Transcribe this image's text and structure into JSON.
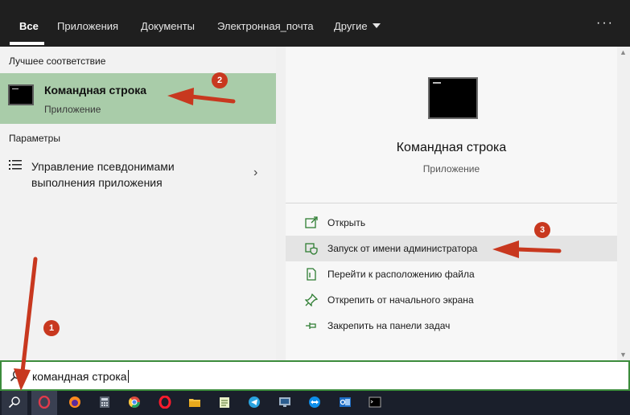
{
  "tabs": {
    "all": "Все",
    "apps": "Приложения",
    "documents": "Документы",
    "email": "Электронная_почта",
    "other": "Другие",
    "more": "···"
  },
  "left": {
    "best_match_heading": "Лучшее соответствие",
    "best_match": {
      "title": "Командная строка",
      "subtitle": "Приложение"
    },
    "settings_heading": "Параметры",
    "setting_item": {
      "label": "Управление псевдонимами выполнения приложения"
    }
  },
  "detail": {
    "title": "Командная строка",
    "subtitle": "Приложение",
    "actions": [
      {
        "label": "Открыть",
        "icon": "open-icon"
      },
      {
        "label": "Запуск от имени администратора",
        "icon": "admin-shield-icon"
      },
      {
        "label": "Перейти к расположению файла",
        "icon": "file-location-icon"
      },
      {
        "label": "Открепить от начального экрана",
        "icon": "unpin-icon"
      },
      {
        "label": "Закрепить на панели задач",
        "icon": "pin-icon"
      }
    ]
  },
  "search": {
    "value": "командная строка"
  },
  "taskbar_icons": [
    "search-icon",
    "opera-icon",
    "firefox-icon",
    "calculator-icon",
    "chrome-icon",
    "opera-browser-icon",
    "file-explorer-icon",
    "notepad-icon",
    "telegram-icon",
    "remote-desktop-icon",
    "teamviewer-icon",
    "outlook-icon",
    "cmd-icon"
  ],
  "callouts": [
    "1",
    "2",
    "3"
  ],
  "colors": {
    "best_match_bg": "#a9cca9",
    "search_border": "#3c8c3c",
    "callout": "#c8381f",
    "topbar": "#1f1f1f",
    "taskbar": "#1a1f2b"
  }
}
